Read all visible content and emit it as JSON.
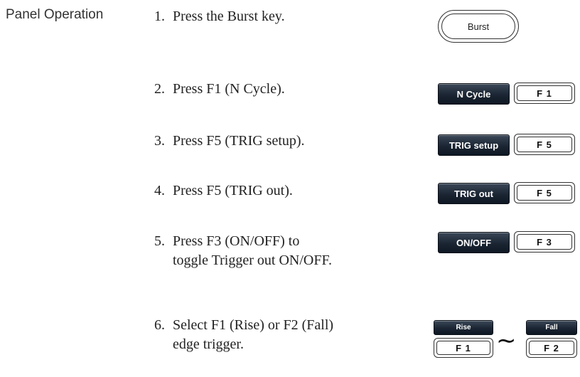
{
  "section_label": "Panel Operation",
  "steps": [
    {
      "num": "1.",
      "text": "Press the Burst key."
    },
    {
      "num": "2.",
      "text": "Press F1 (N Cycle)."
    },
    {
      "num": "3.",
      "text": "Press F5 (TRIG setup)."
    },
    {
      "num": "4.",
      "text": "Press F5 (TRIG out)."
    },
    {
      "num": "5.",
      "text": "Press F3 (ON/OFF) to",
      "text2": "toggle Trigger out ON/OFF."
    },
    {
      "num": "6.",
      "text": "Select F1 (Rise) or F2 (Fall)",
      "text2": "edge trigger."
    }
  ],
  "keys": {
    "burst": "Burst",
    "n_cycle": "N Cycle",
    "f1": "F 1",
    "trig_setup": "TRIG setup",
    "f5": "F 5",
    "trig_out": "TRIG out",
    "on_off": "ON/OFF",
    "f3": "F 3",
    "rise": "Rise",
    "fall": "Fall",
    "f2": "F 2"
  },
  "icons": {
    "range": "tilde-icon"
  }
}
